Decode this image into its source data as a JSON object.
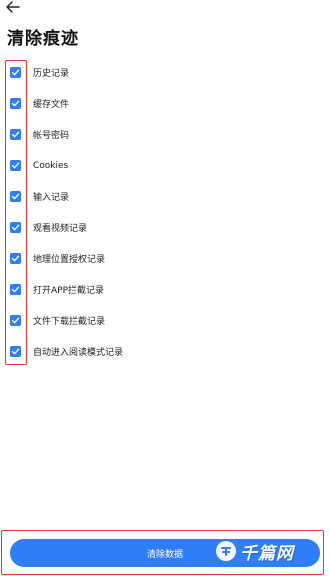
{
  "header": {
    "back_icon": "arrow-left-icon",
    "title": "清除痕迹"
  },
  "items": [
    {
      "label": "历史记录",
      "checked": true
    },
    {
      "label": "缓存文件",
      "checked": true
    },
    {
      "label": "帐号密码",
      "checked": true
    },
    {
      "label": "Cookies",
      "checked": true
    },
    {
      "label": "输入记录",
      "checked": true
    },
    {
      "label": "观看视频记录",
      "checked": true
    },
    {
      "label": "地理位置授权记录",
      "checked": true
    },
    {
      "label": "打开APP拦截记录",
      "checked": true
    },
    {
      "label": "文件下载拦截记录",
      "checked": true
    },
    {
      "label": "自动进入阅读模式记录",
      "checked": true
    }
  ],
  "footer": {
    "clear_button_label": "清除数据"
  },
  "watermark": {
    "text": "千篇网"
  },
  "colors": {
    "accent": "#2f7ef7",
    "annotation": "#e03a3a"
  }
}
